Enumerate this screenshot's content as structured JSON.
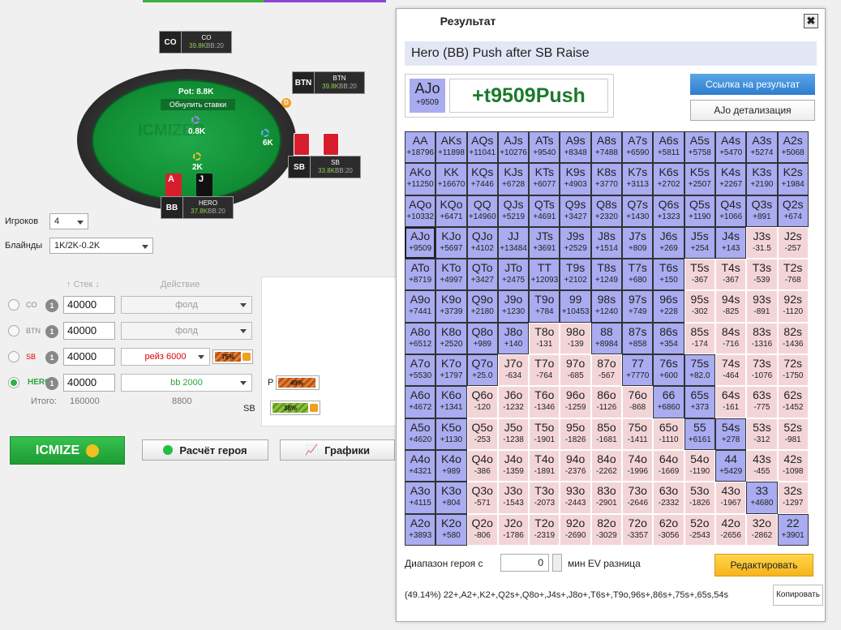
{
  "table": {
    "pot_label": "Pot: 8.8K",
    "reset_label": "Обнулить ставки",
    "watermark": "ICMIZER",
    "pot_chips": "0.8K",
    "btn_chips": "6K",
    "sb_chips": "2K",
    "dealer": "D",
    "seats": {
      "co": {
        "pos": "CO",
        "name": "CO",
        "stack": "39.8K",
        "bb": "BB:20"
      },
      "btn": {
        "pos": "BTN",
        "name": "BTN",
        "stack": "39.8K",
        "bb": "BB:20"
      },
      "sb": {
        "pos": "SB",
        "name": "SB",
        "stack": "33.8K",
        "bb": "BB:20"
      },
      "bb": {
        "pos": "BB",
        "name": "HERO",
        "stack": "37.8K",
        "bb": "BB:20"
      }
    },
    "hero_cards": [
      "A",
      "J"
    ]
  },
  "settings": {
    "players_label": "Игроков",
    "players_value": "4",
    "blinds_label": "Блайнды",
    "blinds_value": "1K/2K-0.2K",
    "col_stack": "Стек",
    "col_action": "Действие",
    "rows": [
      {
        "name": "CO",
        "badge": "1",
        "stack": "40000",
        "action": "фолд"
      },
      {
        "name": "BTN",
        "badge": "1",
        "stack": "40000",
        "action": "фолд"
      },
      {
        "name": "SB",
        "badge": "1",
        "stack": "40000",
        "action": "рейз 6000",
        "pct": "75%"
      },
      {
        "name": "HERO",
        "badge": "1",
        "stack": "40000",
        "action": "bb 2000"
      }
    ],
    "total_label": "Итого:",
    "total_stack": "160000",
    "total_action": "8800",
    "side_p_label": "P",
    "side_p_pct": "49%",
    "side_sb_label": "SB",
    "side_sb_pct": "38%"
  },
  "buttons": {
    "icmize": "ICMIZE",
    "hero_calc": "Расчёт героя",
    "charts": "Графики"
  },
  "result": {
    "tab": "Результат",
    "close": "✖",
    "title": "Hero (BB) Push after SB Raise",
    "hand": "AJo",
    "hand_value": "+9509",
    "ev": "+t9509Push",
    "link_btn": "Ссылка на результат",
    "detail_btn": "AJo детализация",
    "range_label": "Диапазон героя с",
    "range_value": "0",
    "range_label2": "мин EV разница",
    "edit_btn": "Редактировать",
    "range_text": "(49.14%) 22+,A2+,K2+,Q2s+,Q8o+,J4s+,J8o+,T6s+,T9o,96s+,86s+,75s+,65s,54s",
    "copy_btn": "Копировать"
  },
  "grid": [
    [
      [
        "AA",
        "+18796",
        "p"
      ],
      [
        "AKs",
        "+11898",
        "p"
      ],
      [
        "AQs",
        "+11041",
        "p"
      ],
      [
        "AJs",
        "+10276",
        "p"
      ],
      [
        "ATs",
        "+9540",
        "p"
      ],
      [
        "A9s",
        "+8348",
        "p"
      ],
      [
        "A8s",
        "+7488",
        "p"
      ],
      [
        "A7s",
        "+6590",
        "p"
      ],
      [
        "A6s",
        "+5811",
        "p"
      ],
      [
        "A5s",
        "+5758",
        "p"
      ],
      [
        "A4s",
        "+5470",
        "p"
      ],
      [
        "A3s",
        "+5274",
        "p"
      ],
      [
        "A2s",
        "+5068",
        "p"
      ]
    ],
    [
      [
        "AKo",
        "+11250",
        "p"
      ],
      [
        "KK",
        "+16670",
        "p"
      ],
      [
        "KQs",
        "+7446",
        "p"
      ],
      [
        "KJs",
        "+6728",
        "p"
      ],
      [
        "KTs",
        "+6077",
        "p"
      ],
      [
        "K9s",
        "+4903",
        "p"
      ],
      [
        "K8s",
        "+3770",
        "p"
      ],
      [
        "K7s",
        "+3113",
        "p"
      ],
      [
        "K6s",
        "+2702",
        "p"
      ],
      [
        "K5s",
        "+2507",
        "p"
      ],
      [
        "K4s",
        "+2267",
        "p"
      ],
      [
        "K3s",
        "+2190",
        "p"
      ],
      [
        "K2s",
        "+1984",
        "p"
      ]
    ],
    [
      [
        "AQo",
        "+10332",
        "p"
      ],
      [
        "KQo",
        "+6471",
        "p"
      ],
      [
        "QQ",
        "+14960",
        "p"
      ],
      [
        "QJs",
        "+5219",
        "p"
      ],
      [
        "QTs",
        "+4691",
        "p"
      ],
      [
        "Q9s",
        "+3427",
        "p"
      ],
      [
        "Q8s",
        "+2320",
        "p"
      ],
      [
        "Q7s",
        "+1430",
        "p"
      ],
      [
        "Q6s",
        "+1323",
        "p"
      ],
      [
        "Q5s",
        "+1190",
        "p"
      ],
      [
        "Q4s",
        "+1066",
        "p"
      ],
      [
        "Q3s",
        "+891",
        "p"
      ],
      [
        "Q2s",
        "+674",
        "p"
      ]
    ],
    [
      [
        "AJo",
        "+9509",
        "s"
      ],
      [
        "KJo",
        "+5697",
        "p"
      ],
      [
        "QJo",
        "+4102",
        "p"
      ],
      [
        "JJ",
        "+13484",
        "p"
      ],
      [
        "JTs",
        "+3691",
        "p"
      ],
      [
        "J9s",
        "+2529",
        "p"
      ],
      [
        "J8s",
        "+1514",
        "p"
      ],
      [
        "J7s",
        "+809",
        "p"
      ],
      [
        "J6s",
        "+269",
        "p"
      ],
      [
        "J5s",
        "+254",
        "p"
      ],
      [
        "J4s",
        "+143",
        "p"
      ],
      [
        "J3s",
        "-31.5",
        "f"
      ],
      [
        "J2s",
        "-257",
        "f"
      ]
    ],
    [
      [
        "ATo",
        "+8719",
        "p"
      ],
      [
        "KTo",
        "+4997",
        "p"
      ],
      [
        "QTo",
        "+3427",
        "p"
      ],
      [
        "JTo",
        "+2475",
        "p"
      ],
      [
        "TT",
        "+12093",
        "p"
      ],
      [
        "T9s",
        "+2102",
        "p"
      ],
      [
        "T8s",
        "+1249",
        "p"
      ],
      [
        "T7s",
        "+680",
        "p"
      ],
      [
        "T6s",
        "+150",
        "p"
      ],
      [
        "T5s",
        "-367",
        "f"
      ],
      [
        "T4s",
        "-367",
        "f"
      ],
      [
        "T3s",
        "-539",
        "f"
      ],
      [
        "T2s",
        "-768",
        "f"
      ]
    ],
    [
      [
        "A9o",
        "+7441",
        "p"
      ],
      [
        "K9o",
        "+3739",
        "p"
      ],
      [
        "Q9o",
        "+2180",
        "p"
      ],
      [
        "J9o",
        "+1230",
        "p"
      ],
      [
        "T9o",
        "+784",
        "p"
      ],
      [
        "99",
        "+10453",
        "p"
      ],
      [
        "98s",
        "+1240",
        "p"
      ],
      [
        "97s",
        "+749",
        "p"
      ],
      [
        "96s",
        "+228",
        "p"
      ],
      [
        "95s",
        "-302",
        "f"
      ],
      [
        "94s",
        "-825",
        "f"
      ],
      [
        "93s",
        "-891",
        "f"
      ],
      [
        "92s",
        "-1120",
        "f"
      ]
    ],
    [
      [
        "A8o",
        "+6512",
        "p"
      ],
      [
        "K8o",
        "+2520",
        "p"
      ],
      [
        "Q8o",
        "+989",
        "p"
      ],
      [
        "J8o",
        "+140",
        "p"
      ],
      [
        "T8o",
        "-131",
        "f"
      ],
      [
        "98o",
        "-139",
        "f"
      ],
      [
        "88",
        "+8984",
        "p"
      ],
      [
        "87s",
        "+858",
        "p"
      ],
      [
        "86s",
        "+354",
        "p"
      ],
      [
        "85s",
        "-174",
        "f"
      ],
      [
        "84s",
        "-716",
        "f"
      ],
      [
        "83s",
        "-1316",
        "f"
      ],
      [
        "82s",
        "-1436",
        "f"
      ]
    ],
    [
      [
        "A7o",
        "+5530",
        "p"
      ],
      [
        "K7o",
        "+1797",
        "p"
      ],
      [
        "Q7o",
        "+25.0",
        "p"
      ],
      [
        "J7o",
        "-634",
        "f"
      ],
      [
        "T7o",
        "-764",
        "f"
      ],
      [
        "97o",
        "-685",
        "f"
      ],
      [
        "87o",
        "-567",
        "f"
      ],
      [
        "77",
        "+7770",
        "p"
      ],
      [
        "76s",
        "+600",
        "p"
      ],
      [
        "75s",
        "+82.0",
        "p"
      ],
      [
        "74s",
        "-464",
        "f"
      ],
      [
        "73s",
        "-1076",
        "f"
      ],
      [
        "72s",
        "-1750",
        "f"
      ]
    ],
    [
      [
        "A6o",
        "+4672",
        "p"
      ],
      [
        "K6o",
        "+1341",
        "p"
      ],
      [
        "Q6o",
        "-120",
        "f"
      ],
      [
        "J6o",
        "-1232",
        "f"
      ],
      [
        "T6o",
        "-1346",
        "f"
      ],
      [
        "96o",
        "-1259",
        "f"
      ],
      [
        "86o",
        "-1126",
        "f"
      ],
      [
        "76o",
        "-868",
        "f"
      ],
      [
        "66",
        "+6860",
        "p"
      ],
      [
        "65s",
        "+373",
        "p"
      ],
      [
        "64s",
        "-161",
        "f"
      ],
      [
        "63s",
        "-775",
        "f"
      ],
      [
        "62s",
        "-1452",
        "f"
      ]
    ],
    [
      [
        "A5o",
        "+4620",
        "p"
      ],
      [
        "K5o",
        "+1130",
        "p"
      ],
      [
        "Q5o",
        "-253",
        "f"
      ],
      [
        "J5o",
        "-1238",
        "f"
      ],
      [
        "T5o",
        "-1901",
        "f"
      ],
      [
        "95o",
        "-1826",
        "f"
      ],
      [
        "85o",
        "-1681",
        "f"
      ],
      [
        "75o",
        "-1411",
        "f"
      ],
      [
        "65o",
        "-1110",
        "f"
      ],
      [
        "55",
        "+6161",
        "p"
      ],
      [
        "54s",
        "+278",
        "p"
      ],
      [
        "53s",
        "-312",
        "f"
      ],
      [
        "52s",
        "-981",
        "f"
      ]
    ],
    [
      [
        "A4o",
        "+4321",
        "p"
      ],
      [
        "K4o",
        "+989",
        "p"
      ],
      [
        "Q4o",
        "-386",
        "f"
      ],
      [
        "J4o",
        "-1359",
        "f"
      ],
      [
        "T4o",
        "-1891",
        "f"
      ],
      [
        "94o",
        "-2376",
        "f"
      ],
      [
        "84o",
        "-2262",
        "f"
      ],
      [
        "74o",
        "-1996",
        "f"
      ],
      [
        "64o",
        "-1669",
        "f"
      ],
      [
        "54o",
        "-1190",
        "f"
      ],
      [
        "44",
        "+5429",
        "p"
      ],
      [
        "43s",
        "-455",
        "f"
      ],
      [
        "42s",
        "-1098",
        "f"
      ]
    ],
    [
      [
        "A3o",
        "+4115",
        "p"
      ],
      [
        "K3o",
        "+804",
        "p"
      ],
      [
        "Q3o",
        "-571",
        "f"
      ],
      [
        "J3o",
        "-1543",
        "f"
      ],
      [
        "T3o",
        "-2073",
        "f"
      ],
      [
        "93o",
        "-2443",
        "f"
      ],
      [
        "83o",
        "-2901",
        "f"
      ],
      [
        "73o",
        "-2646",
        "f"
      ],
      [
        "63o",
        "-2332",
        "f"
      ],
      [
        "53o",
        "-1826",
        "f"
      ],
      [
        "43o",
        "-1967",
        "f"
      ],
      [
        "33",
        "+4680",
        "p"
      ],
      [
        "32s",
        "-1297",
        "f"
      ]
    ],
    [
      [
        "A2o",
        "+3893",
        "p"
      ],
      [
        "K2o",
        "+580",
        "p"
      ],
      [
        "Q2o",
        "-806",
        "f"
      ],
      [
        "J2o",
        "-1786",
        "f"
      ],
      [
        "T2o",
        "-2319",
        "f"
      ],
      [
        "92o",
        "-2690",
        "f"
      ],
      [
        "82o",
        "-3029",
        "f"
      ],
      [
        "72o",
        "-3357",
        "f"
      ],
      [
        "62o",
        "-3056",
        "f"
      ],
      [
        "52o",
        "-2543",
        "f"
      ],
      [
        "42o",
        "-2656",
        "f"
      ],
      [
        "32o",
        "-2862",
        "f"
      ],
      [
        "22",
        "+3901",
        "p"
      ]
    ]
  ]
}
